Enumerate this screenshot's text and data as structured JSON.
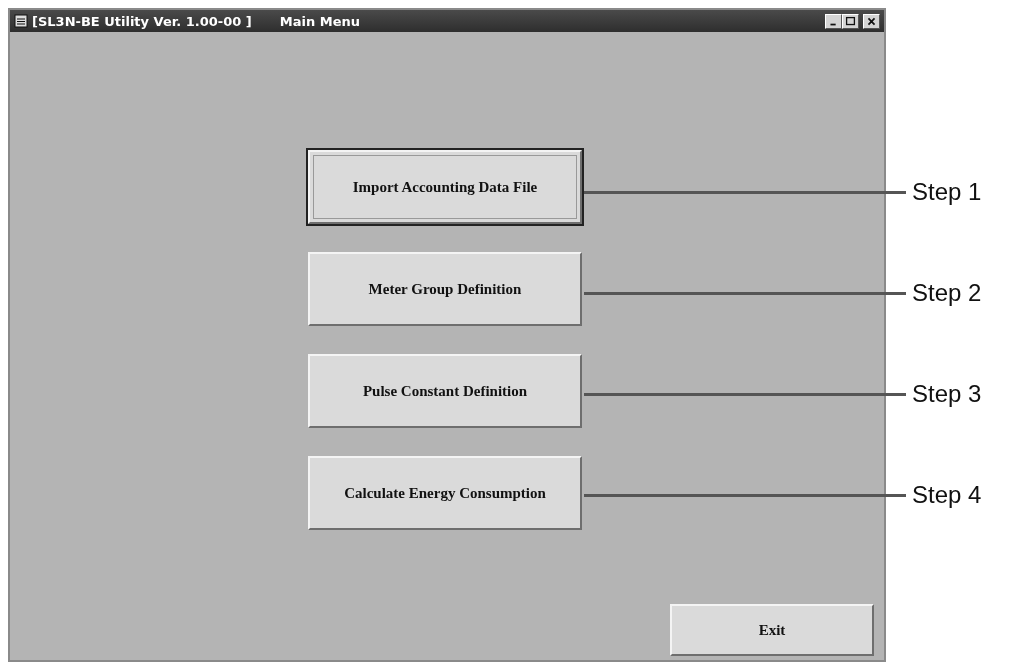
{
  "window": {
    "title": "[SL3N-BE Utility Ver. 1.00-00 ]",
    "subtitle": "Main Menu"
  },
  "menu_buttons": [
    {
      "label": "Import Accounting Data File",
      "focused": true
    },
    {
      "label": "Meter Group Definition",
      "focused": false
    },
    {
      "label": "Pulse Constant Definition",
      "focused": false
    },
    {
      "label": "Calculate Energy Consumption",
      "focused": false
    }
  ],
  "exit_button": {
    "label": "Exit"
  },
  "callouts": [
    {
      "label": "Step 1"
    },
    {
      "label": "Step 2"
    },
    {
      "label": "Step 3"
    },
    {
      "label": "Step 4"
    }
  ]
}
